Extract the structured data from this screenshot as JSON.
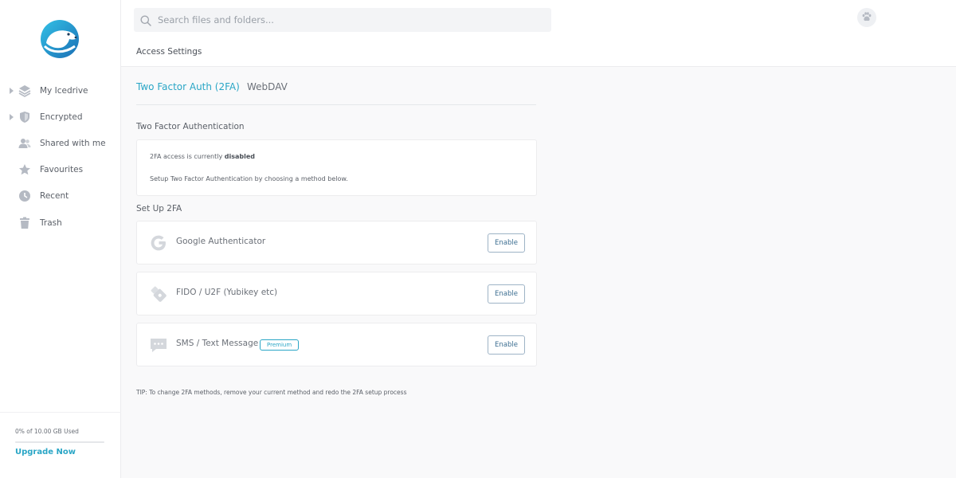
{
  "sidebar": {
    "logo_icon": "polar-bear-logo-icon",
    "items": [
      {
        "label": "My Icedrive",
        "icon": "layers-icon",
        "expandable": true
      },
      {
        "label": "Encrypted",
        "icon": "shield-icon",
        "expandable": true
      },
      {
        "label": "Shared with me",
        "icon": "users-icon",
        "expandable": false
      },
      {
        "label": "Favourites",
        "icon": "star-icon",
        "expandable": false
      },
      {
        "label": "Recent",
        "icon": "clock-icon",
        "expandable": false
      },
      {
        "label": "Trash",
        "icon": "trash-icon",
        "expandable": false
      }
    ],
    "storage": {
      "text": "0% of 10.00 GB Used",
      "used_fraction": 0.0
    },
    "upgrade_label": "Upgrade Now"
  },
  "header": {
    "search": {
      "placeholder": "Search files and folders...",
      "value": ""
    },
    "avatar_icon": "paw-icon",
    "page_title": "Access Settings"
  },
  "tabs": [
    {
      "label": "Two Factor Auth (2FA)",
      "active": true
    },
    {
      "label": "WebDAV",
      "active": false
    }
  ],
  "twofa": {
    "section_title": "Two Factor Authentication",
    "status_prefix": "2FA access is currently",
    "status_value": "disabled",
    "setup_hint": "Setup Two Factor Authentication by choosing a method below."
  },
  "setup": {
    "section_title": "Set Up 2FA",
    "methods": [
      {
        "label": "Google Authenticator",
        "icon": "google-icon",
        "badge": "",
        "button": "Enable"
      },
      {
        "label": "FIDO / U2F (Yubikey etc)",
        "icon": "usb-key-icon",
        "badge": "",
        "button": "Enable"
      },
      {
        "label": "SMS / Text Message",
        "icon": "sms-icon",
        "badge": "Premium",
        "button": "Enable"
      }
    ]
  },
  "tip": "TIP: To change 2FA methods, remove your current method and redo the 2FA setup process",
  "colors": {
    "accent": "#2aa6c6",
    "button_text": "#3c6e91",
    "icon_grey": "#b5bac3"
  }
}
